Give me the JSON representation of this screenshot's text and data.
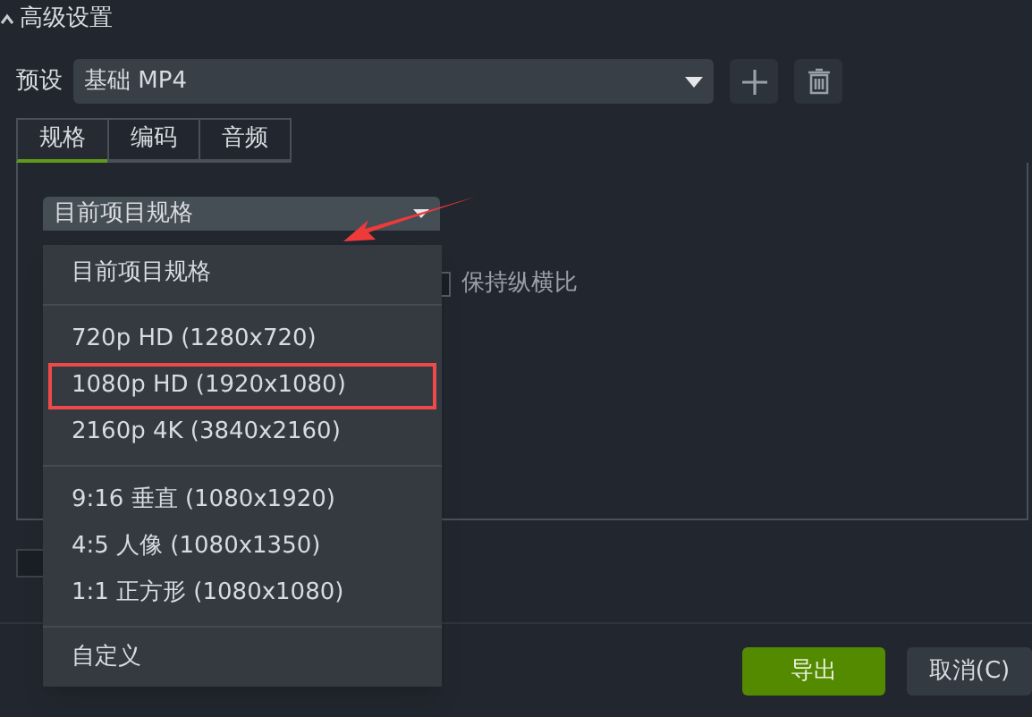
{
  "section": {
    "title": "高级设置",
    "expanded": true
  },
  "preset": {
    "label": "预设",
    "value": "基础 MP4"
  },
  "tabs": [
    {
      "label": "规格",
      "selected": true
    },
    {
      "label": "编码",
      "selected": false
    },
    {
      "label": "音频",
      "selected": false
    }
  ],
  "spec_dropdown": {
    "value": "目前项目规格",
    "open": true,
    "groups": [
      [
        {
          "label": "目前项目规格",
          "highlighted": false
        }
      ],
      [
        {
          "label": "720p HD (1280x720)",
          "highlighted": false
        },
        {
          "label": "1080p HD (1920x1080)",
          "highlighted": true
        },
        {
          "label": "2160p 4K (3840x2160)",
          "highlighted": false
        }
      ],
      [
        {
          "label": "9:16 垂直 (1080x1920)",
          "highlighted": false
        },
        {
          "label": "4:5 人像 (1080x1350)",
          "highlighted": false
        },
        {
          "label": "1:1 正方形 (1080x1080)",
          "highlighted": false
        }
      ],
      [
        {
          "label": "自定义",
          "highlighted": false
        }
      ]
    ]
  },
  "keep_aspect": {
    "label": "保持纵横比",
    "checked": false
  },
  "option_checkbox": {
    "checked": false
  },
  "buttons": [
    {
      "label": "导出",
      "kind": "primary"
    },
    {
      "label": "取消(C)",
      "kind": "secondary"
    }
  ]
}
